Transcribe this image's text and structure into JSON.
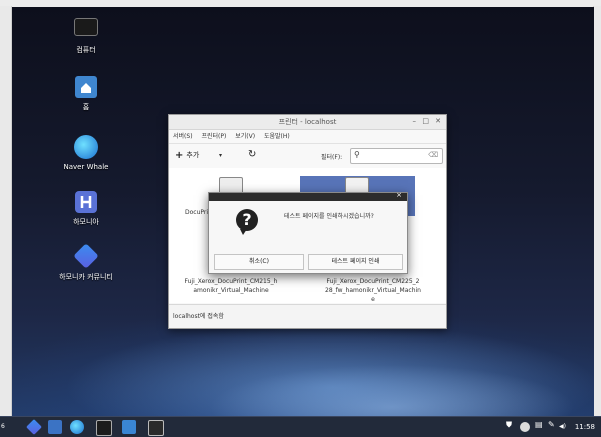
{
  "desktop": {
    "icons": [
      {
        "label": "컴퓨터"
      },
      {
        "label": "홈"
      },
      {
        "label": "Naver Whale"
      },
      {
        "label": "하모니아"
      },
      {
        "label": "하모니카 커뮤니티"
      }
    ]
  },
  "printer_window": {
    "title": "프린터 - localhost",
    "controls": {
      "minimize": "–",
      "maximize": "□",
      "close": "✕"
    },
    "menu": [
      "서버(S)",
      "프린터(P)",
      "보기(V)",
      "도움말(H)"
    ],
    "toolbar": {
      "add_label": "추가",
      "add_symbol": "+",
      "dropdown_symbol": "▾",
      "refresh_symbol": "↻",
      "filter_label": "필터(F):",
      "filter_value": ""
    },
    "printers": [
      {
        "name_line1": "Fuji_Xerox_DocuPrint_CM215_h",
        "name_line2": "amonikr_Virtual_Machine",
        "partial_label": "DocuPri"
      },
      {
        "name_line1": "Fuji_Xerox_DocuPrint_CM225_2",
        "name_line2": "28_fw_hamonikr_Virtual_Machin",
        "name_line3": "e",
        "selected": true
      }
    ],
    "status": "localhost에 접속함"
  },
  "dialog": {
    "message": "테스트 페이지를 인쇄하시겠습니까?",
    "cancel_label": "취소(C)",
    "print_label": "테스트 페이지 인쇄",
    "close_symbol": "×",
    "icon_symbol": "?"
  },
  "taskbar": {
    "left_label": "6",
    "clock": "11:58",
    "volume": "◀)",
    "colors": {
      "bg": "#222a3a",
      "accent": "#2a7bd8"
    }
  }
}
